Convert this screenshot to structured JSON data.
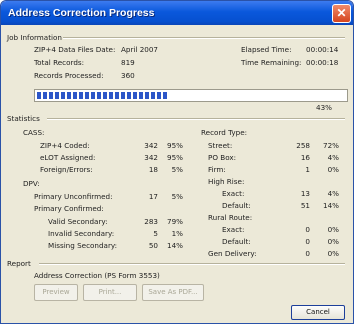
{
  "window": {
    "title": "Address Correction Progress"
  },
  "job": {
    "section_label": "Job Information",
    "zip_label": "ZIP+4 Data Files Date:",
    "zip_value": "April 2007",
    "total_label": "Total Records:",
    "total_value": "819",
    "processed_label": "Records Processed:",
    "processed_value": "360",
    "elapsed_label": "Elapsed Time:",
    "elapsed_value": "00:00:14",
    "remaining_label": "Time Remaining:",
    "remaining_value": "00:00:18",
    "progress_fraction": 0.43,
    "progress_text": "43%"
  },
  "stats": {
    "section_label": "Statistics",
    "cass": {
      "label": "CASS:",
      "rows": [
        {
          "label": "ZIP+4 Coded:",
          "count": "342",
          "pct": "95%"
        },
        {
          "label": "eLOT Assigned:",
          "count": "342",
          "pct": "95%"
        },
        {
          "label": "Foreign/Errors:",
          "count": "18",
          "pct": "5%"
        }
      ]
    },
    "dpv": {
      "label": "DPV:",
      "unconfirmed": {
        "label": "Primary Unconfirmed:",
        "count": "17",
        "pct": "5%"
      },
      "confirmed_label": "Primary Confirmed:",
      "rows": [
        {
          "label": "Valid Secondary:",
          "count": "283",
          "pct": "79%"
        },
        {
          "label": "Invalid Secondary:",
          "count": "5",
          "pct": "1%"
        },
        {
          "label": "Missing Secondary:",
          "count": "50",
          "pct": "14%"
        }
      ]
    },
    "record_type": {
      "label": "Record Type:",
      "street": {
        "label": "Street:",
        "count": "258",
        "pct": "72%"
      },
      "pobox": {
        "label": "PO Box:",
        "count": "16",
        "pct": "4%"
      },
      "firm": {
        "label": "Firm:",
        "count": "1",
        "pct": "0%"
      },
      "highrise_label": "High Rise:",
      "highrise": [
        {
          "label": "Exact:",
          "count": "13",
          "pct": "4%"
        },
        {
          "label": "Default:",
          "count": "51",
          "pct": "14%"
        }
      ],
      "rural_label": "Rural Route:",
      "rural": [
        {
          "label": "Exact:",
          "count": "0",
          "pct": "0%"
        },
        {
          "label": "Default:",
          "count": "0",
          "pct": "0%"
        }
      ],
      "gen": {
        "label": "Gen Delivery:",
        "count": "0",
        "pct": "0%"
      }
    }
  },
  "report": {
    "section_label": "Report",
    "name": "Address Correction (PS Form 3553)",
    "preview": "Preview",
    "print": "Print...",
    "save_pdf": "Save As PDF..."
  },
  "cancel": "Cancel",
  "colors": {
    "titlebar": "#0a58dc",
    "progress": "#2c56c8",
    "dialog_bg": "#ece9d8"
  }
}
